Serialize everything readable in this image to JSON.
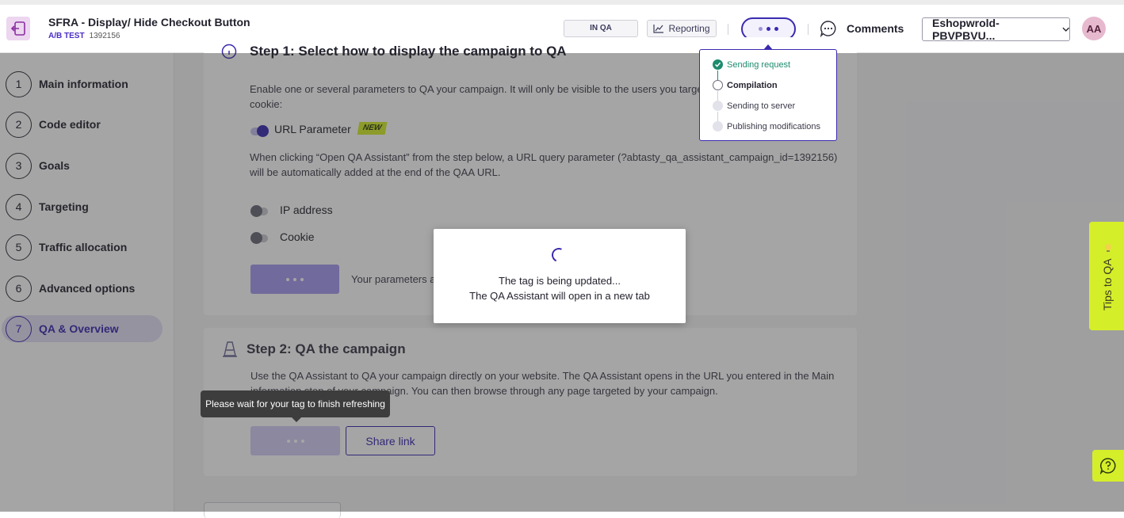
{
  "header": {
    "title": "SFRA - Display/ Hide Checkout Button",
    "test_type": "A/B TEST",
    "test_id": "1392156",
    "status_badge": "IN QA",
    "reporting_label": "Reporting",
    "comments_label": "Comments",
    "account_name": "Eshopwrold-PBVPBVU...",
    "avatar_initials": "AA"
  },
  "sidebar": {
    "steps": [
      {
        "num": "1",
        "label": "Main information"
      },
      {
        "num": "2",
        "label": "Code editor"
      },
      {
        "num": "3",
        "label": "Goals"
      },
      {
        "num": "4",
        "label": "Targeting"
      },
      {
        "num": "5",
        "label": "Traffic allocation"
      },
      {
        "num": "6",
        "label": "Advanced options"
      },
      {
        "num": "7",
        "label": "QA & Overview"
      }
    ],
    "active_step": "7"
  },
  "step1": {
    "title": "Step 1: Select how to display the campaign to QA",
    "intro_line1": "Enable one or several parameters to QA your campaign. It will only be visible to the users you target",
    "intro_line2": "cookie:",
    "url_param_label": "URL Parameter",
    "new_badge": "NEW",
    "url_help_line1": "When clicking “Open QA Assistant” from the step below, a URL query parameter (?abtasty_qa_assistant_campaign_id=1392156)",
    "url_help_line2": "will be automatically added at the end of the QAA URL.",
    "ip_label": "IP address",
    "cookie_label": "Cookie",
    "save_note": "Your parameters a"
  },
  "step2": {
    "title": "Step 2: QA the campaign",
    "desc_line1": "Use the QA Assistant to QA your campaign directly on your website. The QA Assistant opens in the URL you entered in the Main",
    "desc_line2": "information step of your campaign. You can then browse through any page targeted by your campaign.",
    "share_link_label": "Share link"
  },
  "tooltip": "Please wait for your tag to finish refreshing",
  "modal": {
    "line1": "The tag is being updated...",
    "line2": "The QA Assistant will open in a new tab"
  },
  "progress": {
    "steps": [
      {
        "label": "Sending request",
        "state": "done"
      },
      {
        "label": "Compilation",
        "state": "current"
      },
      {
        "label": "Sending to server",
        "state": "pending"
      },
      {
        "label": "Publishing modifications",
        "state": "pending"
      }
    ]
  },
  "tips_label": "Tips to QA",
  "colors": {
    "accent": "#3a2ab0",
    "success": "#1d8b6e",
    "tips_bg": "#d5ee2a"
  }
}
